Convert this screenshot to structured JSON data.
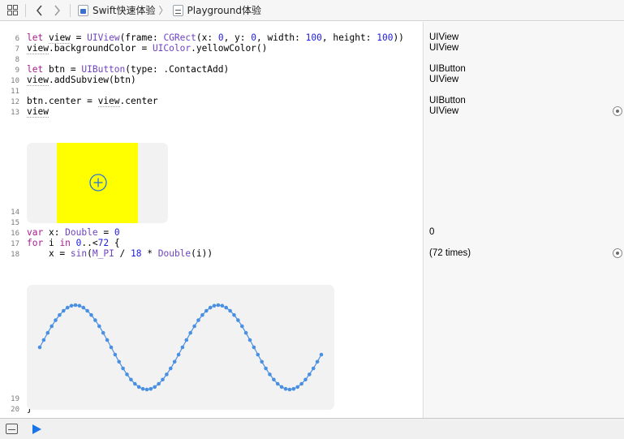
{
  "jumpbar": {
    "grid_icon": "grid-icon",
    "back_icon": "chevron-left-icon",
    "forward_icon": "chevron-right-icon",
    "project": "Swift快速体验",
    "separator": "〉",
    "file": "Playground体验"
  },
  "lines": [
    {
      "n": "6",
      "code": "let view = UIView(frame: CGRect(x: 0, y: 0, width: 100, height: 100))",
      "result": "UIView"
    },
    {
      "n": "7",
      "code": "view.backgroundColor = UIColor.yellowColor()",
      "result": "UIView"
    },
    {
      "n": "8",
      "code": "",
      "result": ""
    },
    {
      "n": "9",
      "code": "let btn = UIButton(type: .ContactAdd)",
      "result": "UIButton"
    },
    {
      "n": "10",
      "code": "view.addSubview(btn)",
      "result": "UIView"
    },
    {
      "n": "11",
      "code": "",
      "result": ""
    },
    {
      "n": "12",
      "code": "btn.center = view.center",
      "result": "UIButton"
    },
    {
      "n": "13",
      "code": "view",
      "result": "UIView"
    },
    {
      "n": "14",
      "code": "",
      "result": ""
    },
    {
      "n": "15",
      "code": "",
      "result": ""
    },
    {
      "n": "16",
      "code": "var x: Double = 0",
      "result": "0"
    },
    {
      "n": "17",
      "code": "for i in 0..<72 {",
      "result": ""
    },
    {
      "n": "18",
      "code": "    x = sin(M_PI / 18 * Double(i))",
      "result": "(72 times)"
    },
    {
      "n": "19",
      "code": "",
      "result": ""
    },
    {
      "n": "20",
      "code": "}",
      "result": ""
    }
  ],
  "preview": {
    "view_color": "#ffff00",
    "button_icon": "plus-circle-icon"
  },
  "chart_data": {
    "type": "scatter",
    "title": "",
    "xlabel": "",
    "ylabel": "",
    "series": [
      {
        "color": "#4a90e2",
        "formula": "sin(M_PI / 18 * Double(i))",
        "i_start": 0,
        "count": 72
      }
    ],
    "ylim": [
      -1,
      1
    ]
  },
  "debugbar": {
    "toggle_icon": "debug-area-toggle-icon",
    "run_icon": "play-icon"
  },
  "colors": {
    "keyword": "#a81d8f",
    "type": "#6f42c1",
    "number": "#1c1ce0"
  }
}
